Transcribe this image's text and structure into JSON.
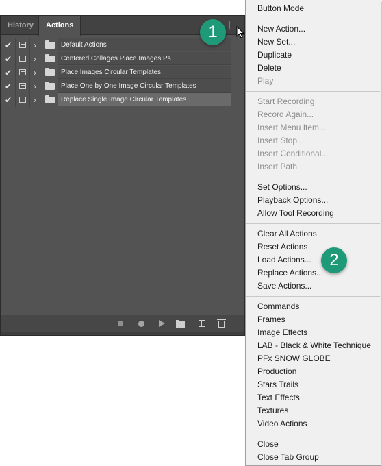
{
  "panel": {
    "tabs": [
      {
        "label": "History",
        "active": false
      },
      {
        "label": "Actions",
        "active": true
      }
    ],
    "action_sets": [
      {
        "name": "Default Actions",
        "checked": true,
        "selected": false
      },
      {
        "name": "Centered Collages Place Images Ps",
        "checked": true,
        "selected": false
      },
      {
        "name": "Place Images Circular Templates",
        "checked": true,
        "selected": false
      },
      {
        "name": "Place One by One Image Circular Templates",
        "checked": true,
        "selected": false
      },
      {
        "name": "Replace Single Image Circular Templates",
        "checked": true,
        "selected": true
      }
    ],
    "bottom_icons": [
      "stop-icon",
      "record-icon",
      "play-icon",
      "new-set-icon",
      "new-action-icon",
      "trash-icon"
    ]
  },
  "menu": {
    "groups": [
      [
        {
          "label": "Button Mode",
          "disabled": false
        }
      ],
      [
        {
          "label": "New Action...",
          "disabled": false
        },
        {
          "label": "New Set...",
          "disabled": false
        },
        {
          "label": "Duplicate",
          "disabled": false
        },
        {
          "label": "Delete",
          "disabled": false
        },
        {
          "label": "Play",
          "disabled": true
        }
      ],
      [
        {
          "label": "Start Recording",
          "disabled": true
        },
        {
          "label": "Record Again...",
          "disabled": true
        },
        {
          "label": "Insert Menu Item...",
          "disabled": true
        },
        {
          "label": "Insert Stop...",
          "disabled": true
        },
        {
          "label": "Insert Conditional...",
          "disabled": true
        },
        {
          "label": "Insert Path",
          "disabled": true
        }
      ],
      [
        {
          "label": "Set Options...",
          "disabled": false
        },
        {
          "label": "Playback Options...",
          "disabled": false
        },
        {
          "label": "Allow Tool Recording",
          "disabled": false
        }
      ],
      [
        {
          "label": "Clear All Actions",
          "disabled": false
        },
        {
          "label": "Reset Actions",
          "disabled": false
        },
        {
          "label": "Load Actions...",
          "disabled": false
        },
        {
          "label": "Replace Actions...",
          "disabled": false
        },
        {
          "label": "Save Actions...",
          "disabled": false
        }
      ],
      [
        {
          "label": "Commands",
          "disabled": false
        },
        {
          "label": "Frames",
          "disabled": false
        },
        {
          "label": "Image Effects",
          "disabled": false
        },
        {
          "label": "LAB - Black & White Technique",
          "disabled": false
        },
        {
          "label": "PFx SNOW GLOBE",
          "disabled": false
        },
        {
          "label": "Production",
          "disabled": false
        },
        {
          "label": "Stars Trails",
          "disabled": false
        },
        {
          "label": "Text Effects",
          "disabled": false
        },
        {
          "label": "Textures",
          "disabled": false
        },
        {
          "label": "Video Actions",
          "disabled": false
        }
      ],
      [
        {
          "label": "Close",
          "disabled": false
        },
        {
          "label": "Close Tab Group",
          "disabled": false
        }
      ]
    ]
  },
  "callouts": [
    {
      "label": "1"
    },
    {
      "label": "2"
    }
  ],
  "colors": {
    "callout": "#1f9a78",
    "panel_bg": "#535353",
    "menu_bg": "#f0f0f0"
  }
}
